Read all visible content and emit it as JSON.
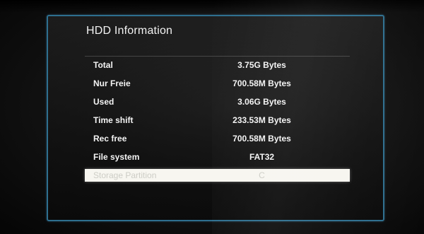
{
  "panel": {
    "title": "HDD Information"
  },
  "rows": [
    {
      "label": "Total",
      "value": "3.75G Bytes"
    },
    {
      "label": "Nur Freie",
      "value": "700.58M Bytes"
    },
    {
      "label": "Used",
      "value": "3.06G Bytes"
    },
    {
      "label": "Time shift",
      "value": "233.53M Bytes"
    },
    {
      "label": "Rec free",
      "value": "700.58M Bytes"
    },
    {
      "label": "File system",
      "value": "FAT32"
    },
    {
      "label": "Storage Partition",
      "value": "C"
    }
  ],
  "selected_row": "Storage Partition",
  "colors": {
    "panel_border": "#2e6f8f",
    "selection_bg": "#f7f6f0"
  }
}
